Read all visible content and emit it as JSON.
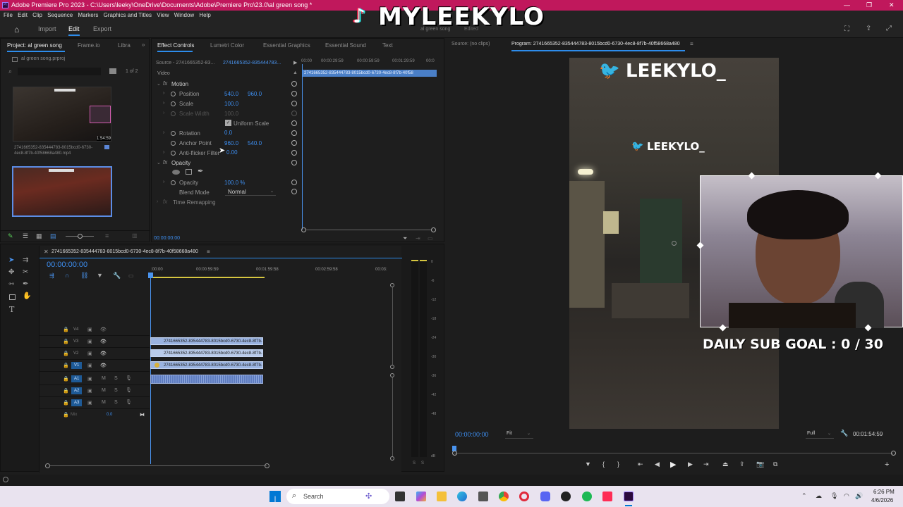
{
  "window": {
    "title": "Adobe Premiere Pro 2023 - C:\\Users\\leeky\\OneDrive\\Documents\\Adobe\\Premiere Pro\\23.0\\al green song *"
  },
  "menu": [
    "File",
    "Edit",
    "Clip",
    "Sequence",
    "Markers",
    "Graphics and Titles",
    "View",
    "Window",
    "Help"
  ],
  "workspace": {
    "home": "Home",
    "import": "Import",
    "edit": "Edit",
    "export": "Export",
    "center_title": "al green song",
    "center_sub": "Edited"
  },
  "overlay": {
    "brand": "MYLEEKYLO"
  },
  "project": {
    "tabs": [
      "Project: al green song",
      "Frame.io",
      "Libra"
    ],
    "file": "al green song.prproj",
    "count": "1 of 2",
    "item1_name": "2741665352-835444783-8015bcd0-6730-4ec8-8f7b-40f58668a480.mp4",
    "item1_dur": "1:54:59"
  },
  "effect_controls": {
    "tabs": [
      "Effect Controls",
      "Lumetri Color",
      "Essential Graphics",
      "Essential Sound",
      "Text"
    ],
    "source": "Source - 2741665352-83...",
    "seq": "2741665352-835444783...",
    "clip_label": "2741665352-835444783-8015bcd0-6730-4ec8-8f7b-40f58",
    "ruler": [
      "00:00",
      "00:00:29:59",
      "00:00:59:59",
      "00:01:29:59",
      "00:0"
    ],
    "video": "Video",
    "motion": "Motion",
    "position": {
      "label": "Position",
      "x": "540.0",
      "y": "960.0"
    },
    "scale": {
      "label": "Scale",
      "v": "100.0"
    },
    "scale_width": {
      "label": "Scale Width",
      "v": "100.0"
    },
    "uniform": "Uniform Scale",
    "rotation": {
      "label": "Rotation",
      "v": "0.0"
    },
    "anchor": {
      "label": "Anchor Point",
      "x": "960.0",
      "y": "540.0"
    },
    "antiflicker": {
      "label": "Anti-flicker Filter",
      "v": "0.00"
    },
    "opacity_section": "Opacity",
    "opacity": {
      "label": "Opacity",
      "v": "100.0 %"
    },
    "blend": {
      "label": "Blend Mode",
      "v": "Normal"
    },
    "time_remap": "Time Remapping",
    "timecode": "00:00:00:00"
  },
  "timeline": {
    "seq_name": "2741665352-835444783-8015bcd0-6730-4ec8-8f7b-40f58668a480",
    "timecode": "00:00:00:00",
    "ruler": [
      ":00:00",
      "00:00:59:59",
      "00:01:59:58",
      "00:02:59:58",
      "00:03:"
    ],
    "video_tracks": [
      "V4",
      "V3",
      "V2",
      "V1"
    ],
    "audio_tracks": [
      "A1",
      "A2",
      "A3"
    ],
    "mix": "Mix",
    "mix_val": "0.0",
    "clip_name": "2741665352-835444783-8015bcd0-6730-4ec8-8f7b-",
    "meter_scale": [
      "0",
      "-6",
      "-12",
      "-18",
      "-24",
      "-30",
      "-36",
      "-42",
      "-48",
      "dB"
    ],
    "solo": [
      "S",
      "S"
    ]
  },
  "source_monitor": {
    "label": "Source: (no clips)"
  },
  "program": {
    "label": "Program: 2741665352-835444783-8015bcd0-6730-4ec8-8f7b-40f58668a480",
    "twitter_big": "LEEKYLO_",
    "twitter_small": "LEEKYLO_",
    "sub_goal": "DAILY SUB GOAL : 0 / 30",
    "timecode": "00:00:00:00",
    "fit": "Fit",
    "quality": "Full",
    "duration": "00:01:54:59"
  },
  "taskbar": {
    "search": "Search",
    "time": "6:26 PM",
    "date": "4/6/2026"
  },
  "colors": {
    "titlebar": "#c0185c",
    "accent": "#2d8ceb",
    "timecode": "#3d8ef0"
  }
}
